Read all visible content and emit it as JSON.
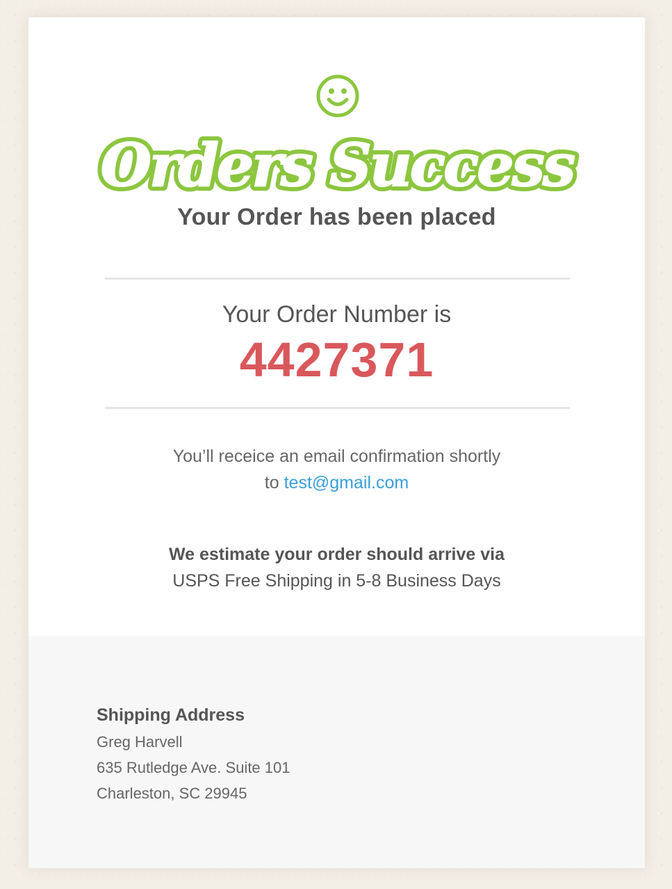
{
  "header": {
    "script_title": "Orders Success",
    "subtitle": "Your Order has been placed"
  },
  "order": {
    "label": "Your Order Number is",
    "number": "4427371"
  },
  "confirmation": {
    "line1": "You’ll receice an email confirmation shortly",
    "prefix": "to",
    "email": "test@gmail.com"
  },
  "estimate": {
    "heading": "We estimate your order should arrive via",
    "details": "USPS Free Shipping in 5-8 Business Days"
  },
  "shipping": {
    "heading": "Shipping Address",
    "name": "Greg Harvell",
    "street": "635 Rutledge Ave. Suite 101",
    "city": "Charleston, SC 29945"
  },
  "colors": {
    "accent_green": "#8cc63f",
    "order_number_red": "#d9585c",
    "link_blue": "#3a9fd9"
  },
  "icons": {
    "smiley": "smiley-face-icon"
  }
}
